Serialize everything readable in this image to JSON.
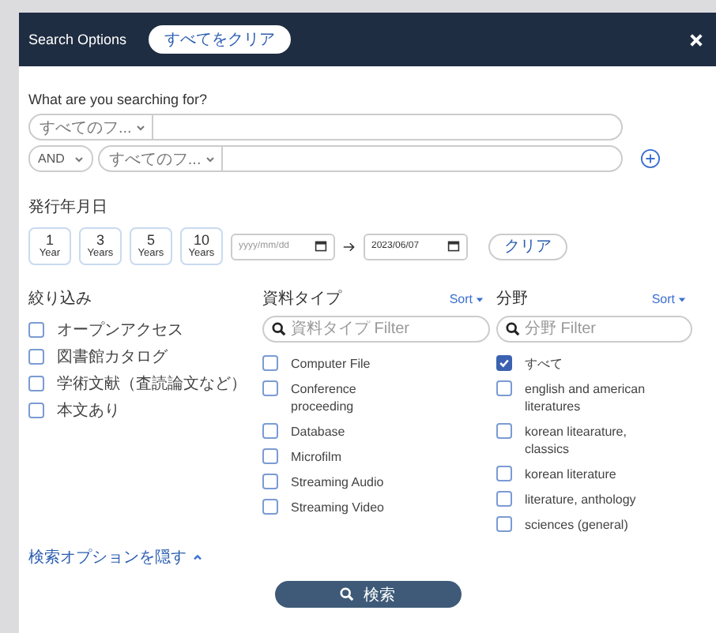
{
  "header": {
    "title": "Search Options",
    "clear_all": "すべてをクリア"
  },
  "query": {
    "label": "What are you searching for?",
    "rows": [
      {
        "field": "すべてのフ...",
        "value": ""
      },
      {
        "operator": "AND",
        "field": "すべてのフ...",
        "value": ""
      }
    ]
  },
  "date": {
    "label": "発行年月日",
    "ranges": [
      {
        "number": "1",
        "unit": "Year"
      },
      {
        "number": "3",
        "unit": "Years"
      },
      {
        "number": "5",
        "unit": "Years"
      },
      {
        "number": "10",
        "unit": "Years"
      }
    ],
    "from": {
      "placeholder": "yyyy/mm/dd"
    },
    "to": {
      "value": "2023/06/07"
    },
    "clear": "クリア"
  },
  "facets": [
    {
      "title": "絞り込み",
      "items": [
        {
          "label": "オープンアクセス",
          "checked": false
        },
        {
          "label": "図書館カタログ",
          "checked": false
        },
        {
          "label": "学術文献（査読論文など）",
          "checked": false
        },
        {
          "label": "本文あり",
          "checked": false
        }
      ]
    },
    {
      "title": "資料タイプ",
      "sort": "Sort",
      "filter": {
        "placeholder": "資料タイプ Filter"
      },
      "items": [
        {
          "label": "Computer File",
          "checked": false
        },
        {
          "label": "Conference proceeding",
          "checked": false
        },
        {
          "label": "Database",
          "checked": false
        },
        {
          "label": "Microfilm",
          "checked": false
        },
        {
          "label": "Streaming Audio",
          "checked": false
        },
        {
          "label": "Streaming Video",
          "checked": false
        }
      ]
    },
    {
      "title": "分野",
      "sort": "Sort",
      "filter": {
        "placeholder": "分野 Filter"
      },
      "items": [
        {
          "label": "すべて",
          "checked": true
        },
        {
          "label": "english and american literatures",
          "checked": false
        },
        {
          "label": "korean litearature, classics",
          "checked": false
        },
        {
          "label": "korean literature",
          "checked": false
        },
        {
          "label": "literature, anthology",
          "checked": false
        },
        {
          "label": "sciences (general)",
          "checked": false
        }
      ]
    }
  ],
  "hide_options": "検索オプションを隠す",
  "search_button": "検索"
}
